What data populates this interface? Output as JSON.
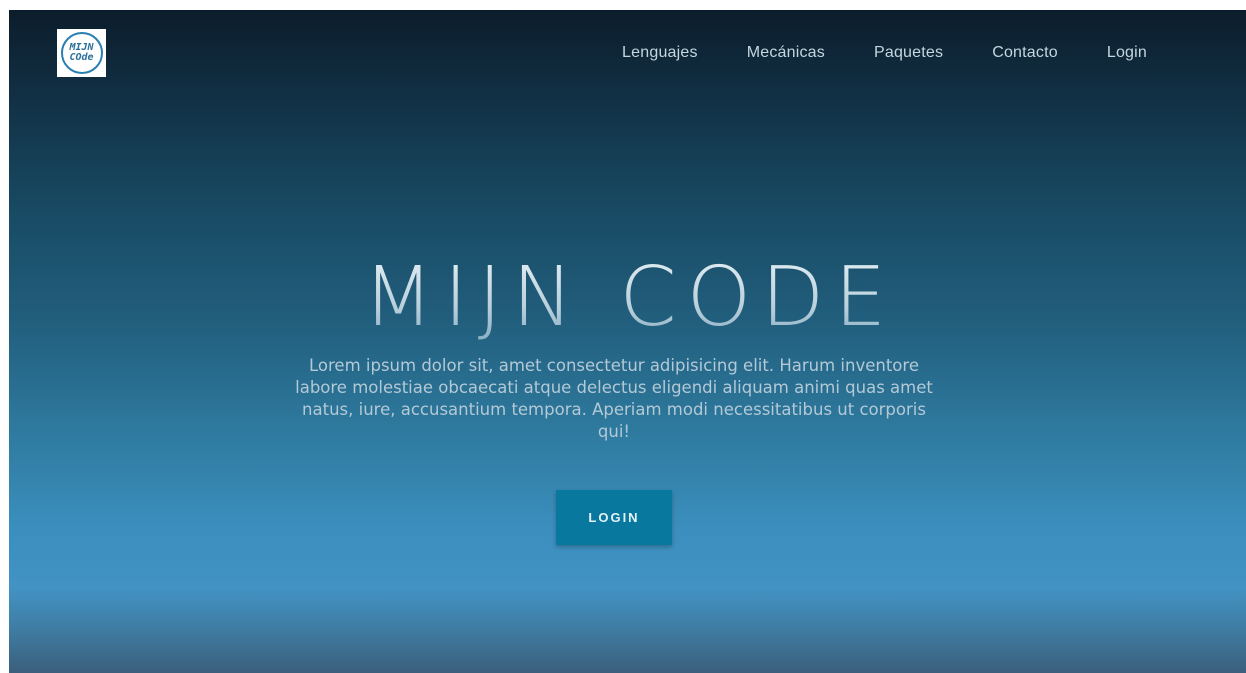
{
  "logo": {
    "line1": "MIJN",
    "line2": "COde"
  },
  "nav": {
    "items": [
      {
        "label": "Lenguajes"
      },
      {
        "label": "Mecánicas"
      },
      {
        "label": "Paquetes"
      },
      {
        "label": "Contacto"
      },
      {
        "label": "Login"
      }
    ]
  },
  "hero": {
    "title": "MIJN CODE",
    "text": "Lorem ipsum dolor sit, amet consectetur adipisicing elit. Harum inventore labore molestiae obcaecati atque delectus eligendi aliquam animi quas amet natus, iure, accusantium tempora. Aperiam modi necessitatibus ut corporis qui!",
    "button_label": "LOGIN"
  },
  "colors": {
    "button": "#08789f",
    "nav_text": "#c4d6e0",
    "hero_gradient_top": "#0b1d2b",
    "hero_gradient_bottom": "#4293c4"
  }
}
